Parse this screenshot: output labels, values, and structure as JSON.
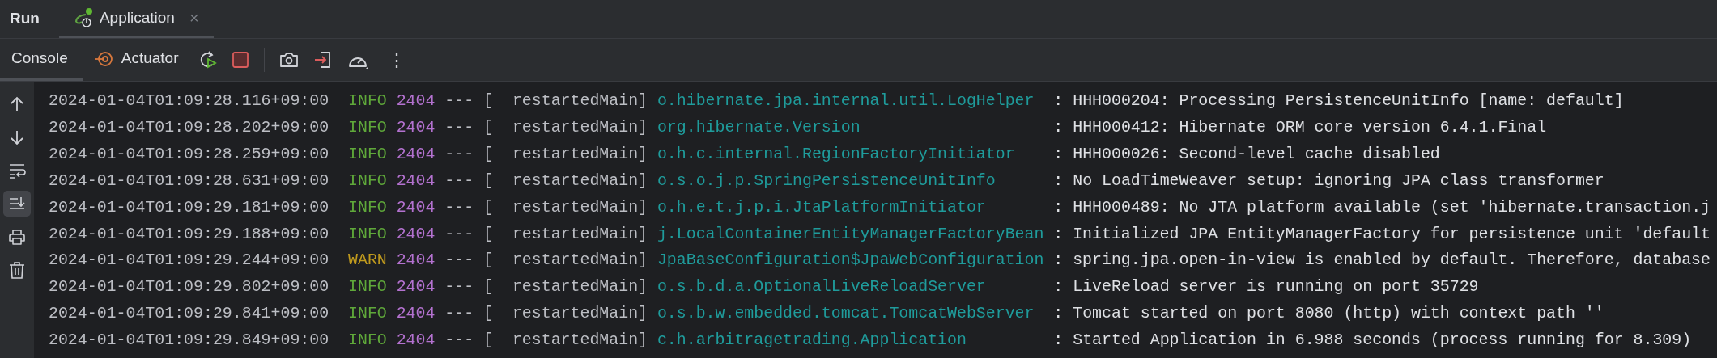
{
  "header": {
    "title": "Run",
    "tabs": [
      {
        "label": "Application",
        "selected": true,
        "close": "×"
      }
    ]
  },
  "toolbar": {
    "tabs": [
      {
        "label": "Console",
        "kind": "console",
        "selected": true
      },
      {
        "label": "Actuator",
        "kind": "actuator",
        "selected": false
      }
    ],
    "more": "⋮"
  },
  "gutter": [
    {
      "kind": "up",
      "on": false
    },
    {
      "kind": "down",
      "on": false
    },
    {
      "kind": "wrap",
      "on": false
    },
    {
      "kind": "scroll_end",
      "on": true
    },
    {
      "kind": "print",
      "on": false
    },
    {
      "kind": "clear",
      "on": false
    }
  ],
  "log": [
    {
      "time": "2024-01-04T01:09:28.116+09:00",
      "level": "INFO",
      "kind": "info",
      "pid": "2404",
      "sep": "---",
      "thread": "[  restartedMain]",
      "logger": "o.hibernate.jpa.internal.util.LogHelper",
      "message": ": HHH000204: Processing PersistenceUnitInfo [name: default]"
    },
    {
      "time": "2024-01-04T01:09:28.202+09:00",
      "level": "INFO",
      "kind": "info",
      "pid": "2404",
      "sep": "---",
      "thread": "[  restartedMain]",
      "logger": "org.hibernate.Version",
      "message": ": HHH000412: Hibernate ORM core version 6.4.1.Final"
    },
    {
      "time": "2024-01-04T01:09:28.259+09:00",
      "level": "INFO",
      "kind": "info",
      "pid": "2404",
      "sep": "---",
      "thread": "[  restartedMain]",
      "logger": "o.h.c.internal.RegionFactoryInitiator",
      "message": ": HHH000026: Second-level cache disabled"
    },
    {
      "time": "2024-01-04T01:09:28.631+09:00",
      "level": "INFO",
      "kind": "info",
      "pid": "2404",
      "sep": "---",
      "thread": "[  restartedMain]",
      "logger": "o.s.o.j.p.SpringPersistenceUnitInfo",
      "message": ": No LoadTimeWeaver setup: ignoring JPA class transformer"
    },
    {
      "time": "2024-01-04T01:09:29.181+09:00",
      "level": "INFO",
      "kind": "info",
      "pid": "2404",
      "sep": "---",
      "thread": "[  restartedMain]",
      "logger": "o.h.e.t.j.p.i.JtaPlatformInitiator",
      "message": ": HHH000489: No JTA platform available (set 'hibernate.transaction.j"
    },
    {
      "time": "2024-01-04T01:09:29.188+09:00",
      "level": "INFO",
      "kind": "info",
      "pid": "2404",
      "sep": "---",
      "thread": "[  restartedMain]",
      "logger": "j.LocalContainerEntityManagerFactoryBean",
      "message": ": Initialized JPA EntityManagerFactory for persistence unit 'default"
    },
    {
      "time": "2024-01-04T01:09:29.244+09:00",
      "level": "WARN",
      "kind": "warn",
      "pid": "2404",
      "sep": "---",
      "thread": "[  restartedMain]",
      "logger": "JpaBaseConfiguration$JpaWebConfiguration",
      "message": ": spring.jpa.open-in-view is enabled by default. Therefore, database"
    },
    {
      "time": "2024-01-04T01:09:29.802+09:00",
      "level": "INFO",
      "kind": "info",
      "pid": "2404",
      "sep": "---",
      "thread": "[  restartedMain]",
      "logger": "o.s.b.d.a.OptionalLiveReloadServer",
      "message": ": LiveReload server is running on port 35729"
    },
    {
      "time": "2024-01-04T01:09:29.841+09:00",
      "level": "INFO",
      "kind": "info",
      "pid": "2404",
      "sep": "---",
      "thread": "[  restartedMain]",
      "logger": "o.s.b.w.embedded.tomcat.TomcatWebServer",
      "message": ": Tomcat started on port 8080 (http) with context path ''"
    },
    {
      "time": "2024-01-04T01:09:29.849+09:00",
      "level": "INFO",
      "kind": "info",
      "pid": "2404",
      "sep": "---",
      "thread": "[  restartedMain]",
      "logger": "c.h.arbitragetrading.Application",
      "message": ": Started Application in 6.988 seconds (process running for 8.309)"
    }
  ]
}
